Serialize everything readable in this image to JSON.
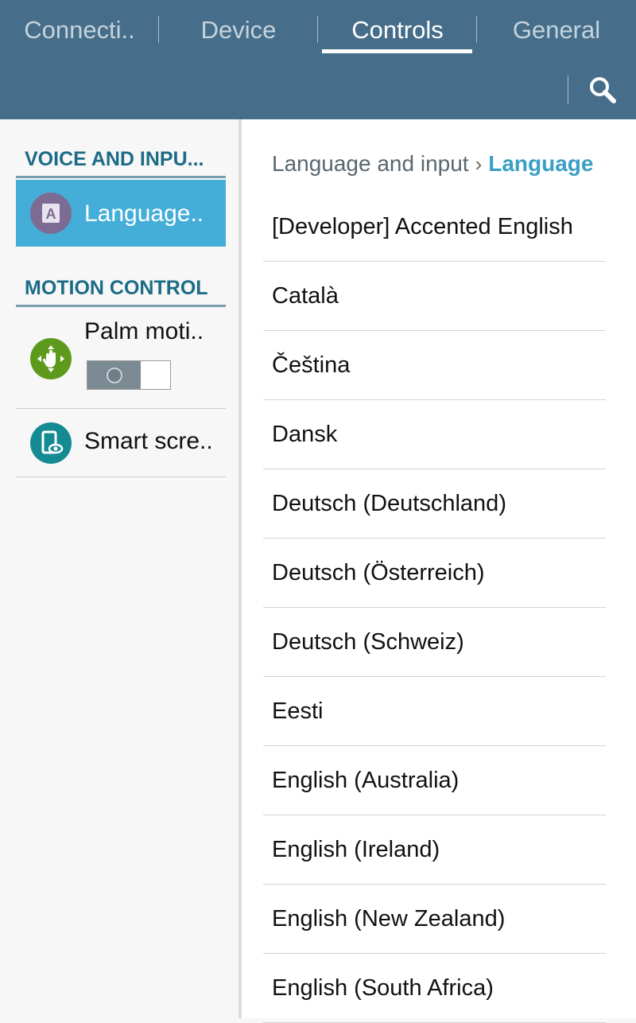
{
  "tabs": [
    {
      "label": "Connecti..",
      "active": false
    },
    {
      "label": "Device",
      "active": false
    },
    {
      "label": "Controls",
      "active": true
    },
    {
      "label": "General",
      "active": false
    }
  ],
  "search": {
    "icon": "search-icon"
  },
  "sidebar": {
    "sections": [
      {
        "title": "VOICE AND INPU...",
        "items": [
          {
            "label": "Language..",
            "icon": "language-icon",
            "selected": true
          }
        ]
      },
      {
        "title": "MOTION CONTROL",
        "items": [
          {
            "label": "Palm moti..",
            "icon": "palm-motion-icon",
            "toggle": "off"
          },
          {
            "label": "Smart scre..",
            "icon": "smart-screen-icon"
          }
        ]
      }
    ]
  },
  "breadcrumb": {
    "parent": "Language and input",
    "separator": "›",
    "current": "Language"
  },
  "languages": [
    "[Developer] Accented English",
    "Català",
    "Čeština",
    "Dansk",
    "Deutsch (Deutschland)",
    "Deutsch (Österreich)",
    "Deutsch (Schweiz)",
    "Eesti",
    "English (Australia)",
    "English (Ireland)",
    "English (New Zealand)",
    "English (South Africa)"
  ],
  "colors": {
    "header": "#466e8a",
    "accent": "#44aed8",
    "section_title": "#1b6b86",
    "breadcrumb_current": "#3b9fc4"
  }
}
